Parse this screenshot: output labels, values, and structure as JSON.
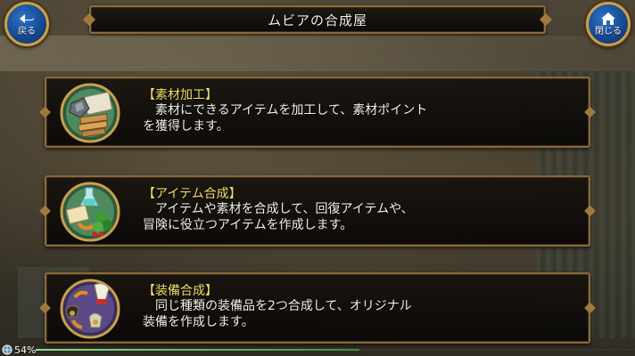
{
  "window": {
    "title": "ムビアの合成屋"
  },
  "nav": {
    "back_label": "戻る",
    "close_label": "閉じる",
    "back_icon": "back-arrow-icon",
    "close_icon": "home-icon"
  },
  "menu": {
    "items": [
      {
        "title": "【素材加工】",
        "desc_lines": [
          "素材にできるアイテムを加工して、素材ポイント",
          "を獲得します。"
        ],
        "icon": "material-processing-icon"
      },
      {
        "title": "【アイテム合成】",
        "desc_lines": [
          "アイテムや素材を合成して、回復アイテムや、",
          "冒険に役立つアイテムを作成します。"
        ],
        "icon": "item-synthesis-icon"
      },
      {
        "title": "【装備合成】",
        "desc_lines": [
          "同じ種類の装備品を2つ合成して、オリジナル",
          "装備を作成します。"
        ],
        "icon": "equipment-synthesis-icon"
      }
    ]
  },
  "status": {
    "value": "54%"
  },
  "colors": {
    "accent_gold": "#c9a04d",
    "title_yellow": "#f2df6a",
    "button_blue": "#164a92"
  }
}
